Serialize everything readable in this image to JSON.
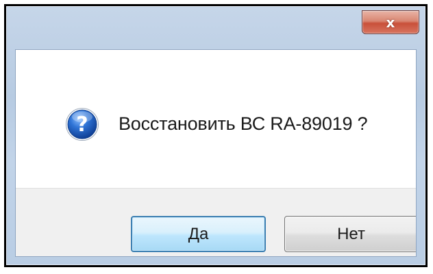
{
  "dialog": {
    "close_glyph": "x",
    "close_icon": "close-icon",
    "message_icon": "question-icon",
    "message": "Восстановить ВС RA-89019 ?",
    "buttons": {
      "yes_label": "Да",
      "no_label": "Нет"
    }
  },
  "colors": {
    "frame": "#b9cde4",
    "close_button": "#c9503a",
    "icon_blue": "#1f5fbf",
    "default_button_border": "#3c7fb1",
    "button_area": "#f0f0f0"
  }
}
